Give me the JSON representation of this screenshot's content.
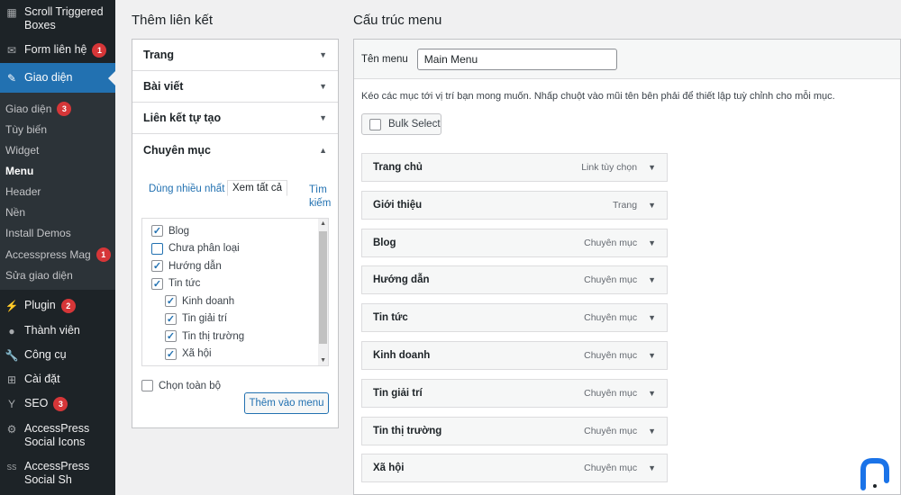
{
  "sidebar": {
    "top_items": [
      {
        "label": "Scroll Triggered Boxes",
        "icon": "scroll-icon"
      },
      {
        "label": "Form liên hệ",
        "icon": "mail-icon",
        "badge": "1"
      }
    ],
    "active_item": {
      "label": "Giao diện",
      "icon": "brush-icon"
    },
    "submenu": [
      {
        "label": "Giao diện",
        "badge": "3"
      },
      {
        "label": "Tùy biến"
      },
      {
        "label": "Widget"
      },
      {
        "label": "Menu",
        "current": true
      },
      {
        "label": "Header"
      },
      {
        "label": "Nền"
      },
      {
        "label": "Install Demos"
      },
      {
        "label": "Accesspress Mag",
        "badge": "1"
      },
      {
        "label": "Sửa giao diện"
      }
    ],
    "bottom_items": [
      {
        "label": "Plugin",
        "icon": "plugin-icon",
        "badge": "2"
      },
      {
        "label": "Thành viên",
        "icon": "user-icon"
      },
      {
        "label": "Công cụ",
        "icon": "wrench-icon"
      },
      {
        "label": "Cài đặt",
        "icon": "settings-icon"
      },
      {
        "label": "SEO",
        "icon": "yoast-icon",
        "badge": "3"
      },
      {
        "label": "AccessPress Social Icons",
        "icon": "gear-icon"
      },
      {
        "label": "AccessPress Social Sh",
        "icon": "ss-icon"
      }
    ]
  },
  "left": {
    "title": "Thêm liên kết",
    "accordion": [
      "Trang",
      "Bài viết",
      "Liên kết tự tạo",
      "Chuyên mục"
    ],
    "tabs": {
      "most_used": "Dùng nhiều nhất",
      "view_all": "Xem tất cả",
      "search": "Tìm kiếm"
    },
    "categories": [
      {
        "label": "Blog",
        "checked": true,
        "level": 0
      },
      {
        "label": "Chưa phân loại",
        "checked": false,
        "level": 0
      },
      {
        "label": "Hướng dẫn",
        "checked": true,
        "level": 0
      },
      {
        "label": "Tin tức",
        "checked": true,
        "level": 0
      },
      {
        "label": "Kinh doanh",
        "checked": true,
        "level": 1
      },
      {
        "label": "Tin giải trí",
        "checked": true,
        "level": 1
      },
      {
        "label": "Tin thị trường",
        "checked": true,
        "level": 1
      },
      {
        "label": "Xã hội",
        "checked": true,
        "level": 1
      }
    ],
    "select_all": "Chọn toàn bộ",
    "add_button": "Thêm vào menu"
  },
  "right": {
    "title": "Cấu trúc menu",
    "menu_name_label": "Tên menu",
    "menu_name_value": "Main Menu",
    "instructions": "Kéo các mục tới vị trí bạn mong muốn. Nhấp chuột vào mũi tên bên phải để thiết lập tuỳ chỉnh cho mỗi mục.",
    "bulk_select": "Bulk Select",
    "items": [
      {
        "title": "Trang chủ",
        "type": "Link tùy chọn"
      },
      {
        "title": "Giới thiệu",
        "type": "Trang"
      },
      {
        "title": "Blog",
        "type": "Chuyên mục"
      },
      {
        "title": "Hướng dẫn",
        "type": "Chuyên mục"
      },
      {
        "title": "Tin tức",
        "type": "Chuyên mục"
      },
      {
        "title": "Kinh doanh",
        "type": "Chuyên mục"
      },
      {
        "title": "Tin giải trí",
        "type": "Chuyên mục"
      },
      {
        "title": "Tin thị trường",
        "type": "Chuyên mục"
      },
      {
        "title": "Xã hội",
        "type": "Chuyên mục"
      }
    ]
  },
  "colors": {
    "accent": "#2271b1",
    "sidebar_bg": "#1d2327",
    "badge": "#d63638"
  }
}
